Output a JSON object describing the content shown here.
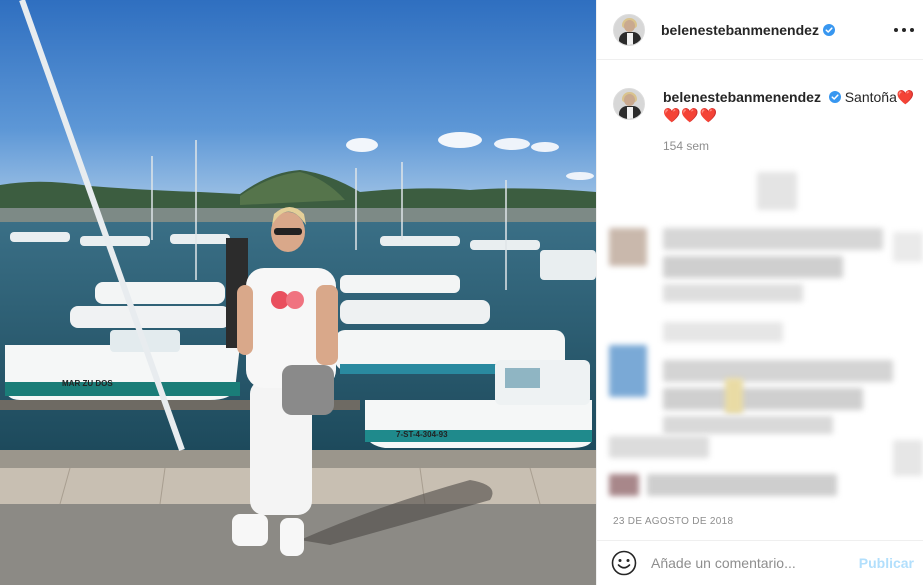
{
  "post": {
    "username": "belenestebanmenendez",
    "caption_text": "Santoña",
    "caption_hearts": "❤️❤️❤️❤️",
    "time_ago": "154 sem",
    "date": "23 DE AGOSTO DE 2018",
    "photo_boat_text_1": "MAR ZU DOS",
    "photo_boat_text_2": "7-ST-4-304-93"
  },
  "comment": {
    "placeholder": "Añade un comentario...",
    "publish_label": "Publicar"
  },
  "icons": {
    "verified": "verified-badge-icon",
    "more": "more-options-icon",
    "emoji": "emoji-smile-icon"
  },
  "colors": {
    "verified_blue": "#3897f0",
    "publish_disabled": "#b2dffc",
    "muted_text": "#8e8e8e",
    "heart_red": "#ed1c24"
  }
}
